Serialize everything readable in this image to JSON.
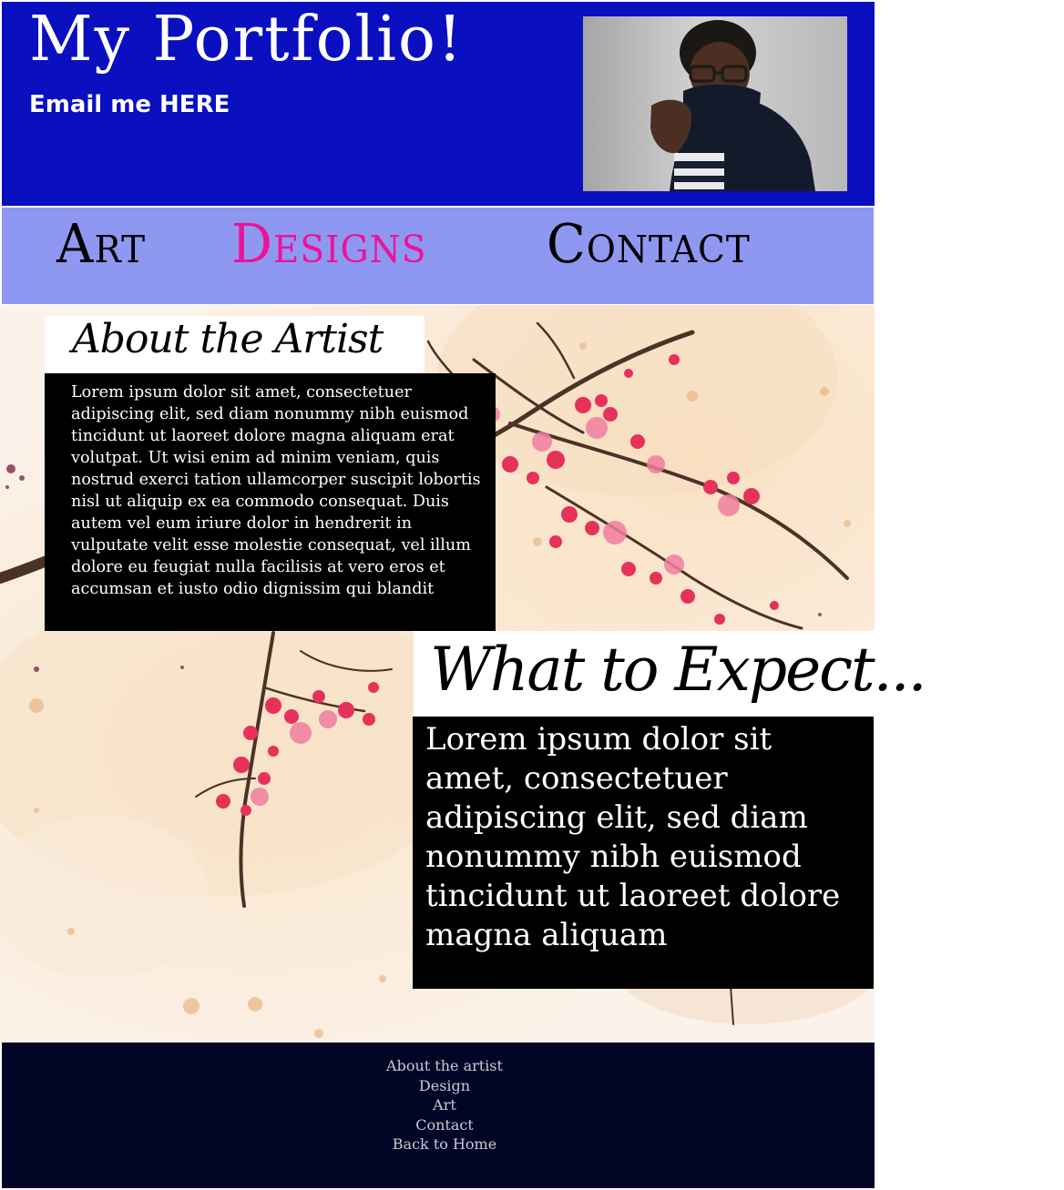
{
  "header": {
    "title": "My Portfolio!",
    "email_link": "Email me HERE"
  },
  "nav": {
    "items": [
      {
        "label": "Art",
        "active": false
      },
      {
        "label": "Designs",
        "active": true
      },
      {
        "label": "Contact",
        "active": false
      }
    ]
  },
  "about": {
    "heading": "About the Artist",
    "body": "Lorem ipsum dolor sit amet, consectetuer adipiscing elit, sed diam nonummy nibh euismod tincidunt ut laoreet dolore magna aliquam erat volutpat. Ut wisi enim ad minim veniam, quis nostrud exerci tation ullamcorper suscipit lobortis nisl ut aliquip ex ea commodo consequat. Duis autem vel eum iriure dolor in hendrerit in vulputate velit esse molestie consequat, vel illum dolore eu feugiat nulla facilisis at vero eros et accumsan et iusto odio dignissim qui blandit"
  },
  "expect": {
    "heading": "What to Expect...",
    "body": "Lorem ipsum dolor sit amet, consectetuer adipiscing elit, sed diam nonummy nibh euismod tincidunt ut laoreet dolore magna aliquam"
  },
  "footer": {
    "links": [
      {
        "label": "About the artist"
      },
      {
        "label": "Design"
      },
      {
        "label": "Art"
      },
      {
        "label": "Contact"
      },
      {
        "label": "Back to Home"
      }
    ]
  },
  "colors": {
    "header_bg": "#0a0fbf",
    "nav_bg": "#8f98f0",
    "active_nav": "#ee1199",
    "footer_bg": "#020626"
  }
}
